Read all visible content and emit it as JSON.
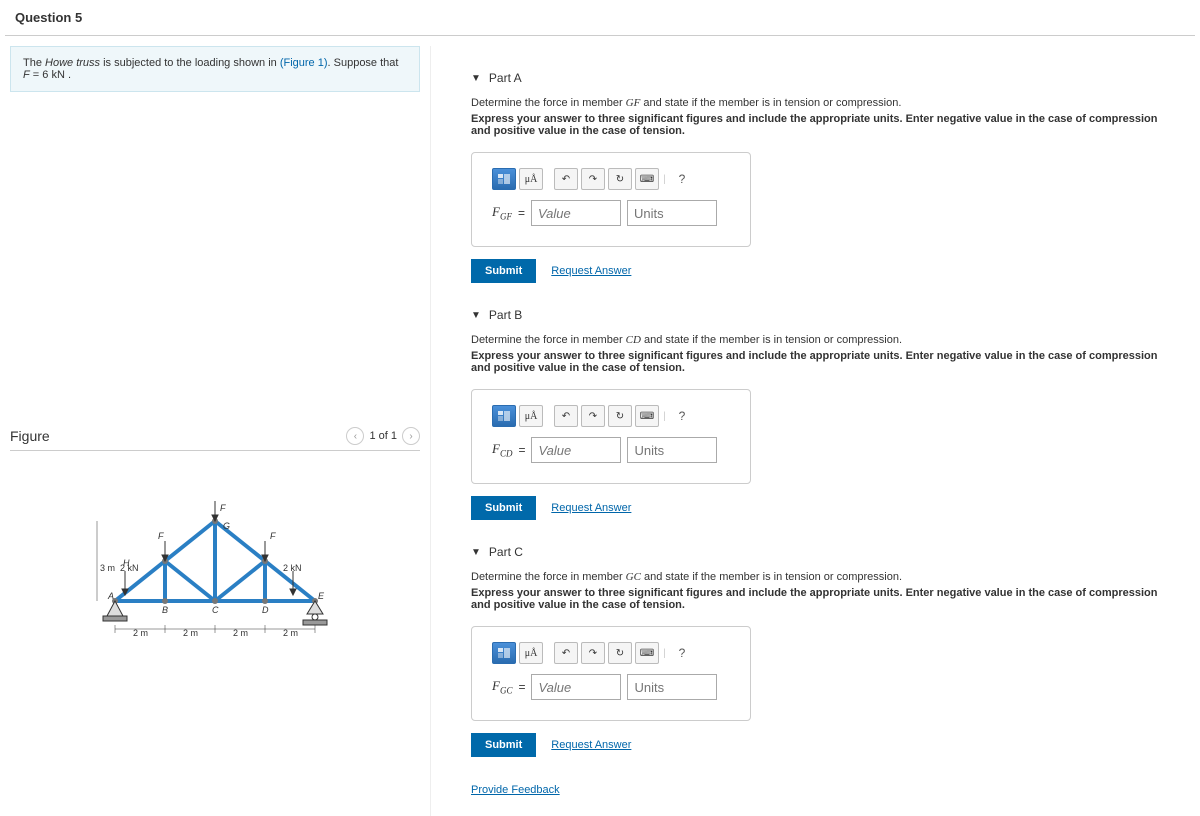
{
  "question_label": "Question 5",
  "problem": {
    "prefix": "The ",
    "truss": "Howe truss",
    "mid": " is subjected to the loading shown in ",
    "figlink": "(Figure 1)",
    "suffix": ". Suppose that ",
    "var": "F",
    "eq": " = 6 kN ."
  },
  "figure": {
    "title": "Figure",
    "pager": "1 of 1"
  },
  "parts": [
    {
      "title": "Part A",
      "member": "GF",
      "varsub": "GF"
    },
    {
      "title": "Part B",
      "member": "CD",
      "varsub": "CD"
    },
    {
      "title": "Part C",
      "member": "GC",
      "varsub": "GC"
    }
  ],
  "common": {
    "desc_prefix": "Determine the force in member ",
    "desc_suffix": " and state if the member is in tension or compression.",
    "instr": "Express your answer to three significant figures and include the appropriate units. Enter negative value in the case of compression and positive value in the case of tension.",
    "value_ph": "Value",
    "units_ph": "Units",
    "submit": "Submit",
    "request": "Request Answer",
    "muA": "μÅ",
    "help": "?",
    "feedback": "Provide Feedback",
    "var_F": "F",
    "equals": " = "
  },
  "chart_data": {
    "type": "diagram",
    "description": "Howe truss structural diagram",
    "nodes": [
      "A",
      "B",
      "C",
      "D",
      "E",
      "F",
      "G",
      "H"
    ],
    "dimensions": {
      "height_m": 3,
      "spans_m": [
        2,
        2,
        2,
        2
      ]
    },
    "loads": [
      {
        "at": "H",
        "label": "2 kN",
        "dir": "down"
      },
      {
        "at": "top_left_F",
        "label": "F",
        "dir": "down"
      },
      {
        "at": "G",
        "label": "F",
        "dir": "down"
      },
      {
        "at": "top_right_F",
        "label": "F",
        "dir": "down"
      },
      {
        "at": "E_left",
        "label": "2 kN",
        "dir": "down"
      }
    ],
    "supports": [
      "A_pin",
      "E_roller"
    ]
  }
}
